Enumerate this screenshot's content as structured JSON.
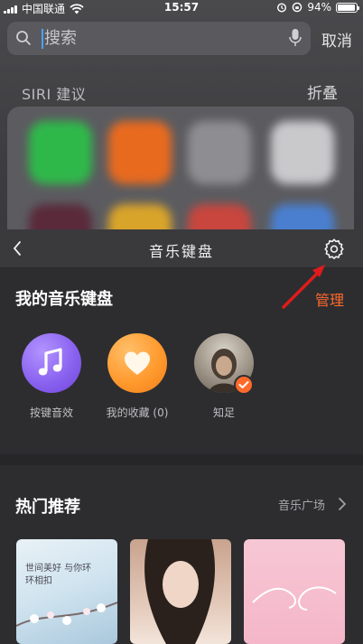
{
  "status_bar": {
    "carrier": "中国联通",
    "time": "15:57",
    "battery": "94%",
    "battery_level": 0.94
  },
  "search": {
    "placeholder": "搜索",
    "cancel_label": "取消"
  },
  "siri": {
    "title": "SIRI 建议",
    "fold_label": "折叠"
  },
  "keyboard": {
    "title": "音乐键盘"
  },
  "my_keyboard": {
    "title": "我的音乐键盘",
    "manage_label": "管理",
    "items": [
      {
        "label": "按键音效",
        "icon": "music-note-icon",
        "color": "#8b63f0"
      },
      {
        "label": "我的收藏 (0)",
        "icon": "heart-icon",
        "color": "#ff9a2e"
      },
      {
        "label": "知足",
        "icon": "avatar-photo",
        "color": "#7a6a5a"
      }
    ]
  },
  "hot": {
    "title": "热门推荐",
    "more_label": "音乐广场",
    "cards": [
      {
        "text": "世间美好 与你环环相扣",
        "color": "#cfe3ef"
      },
      {
        "text": "",
        "color": "#d7b9a6"
      },
      {
        "text": "",
        "color": "#f4b6c8"
      }
    ]
  },
  "colors": {
    "accent": "#ff6a2b",
    "annotation_arrow": "#e01b1b"
  }
}
